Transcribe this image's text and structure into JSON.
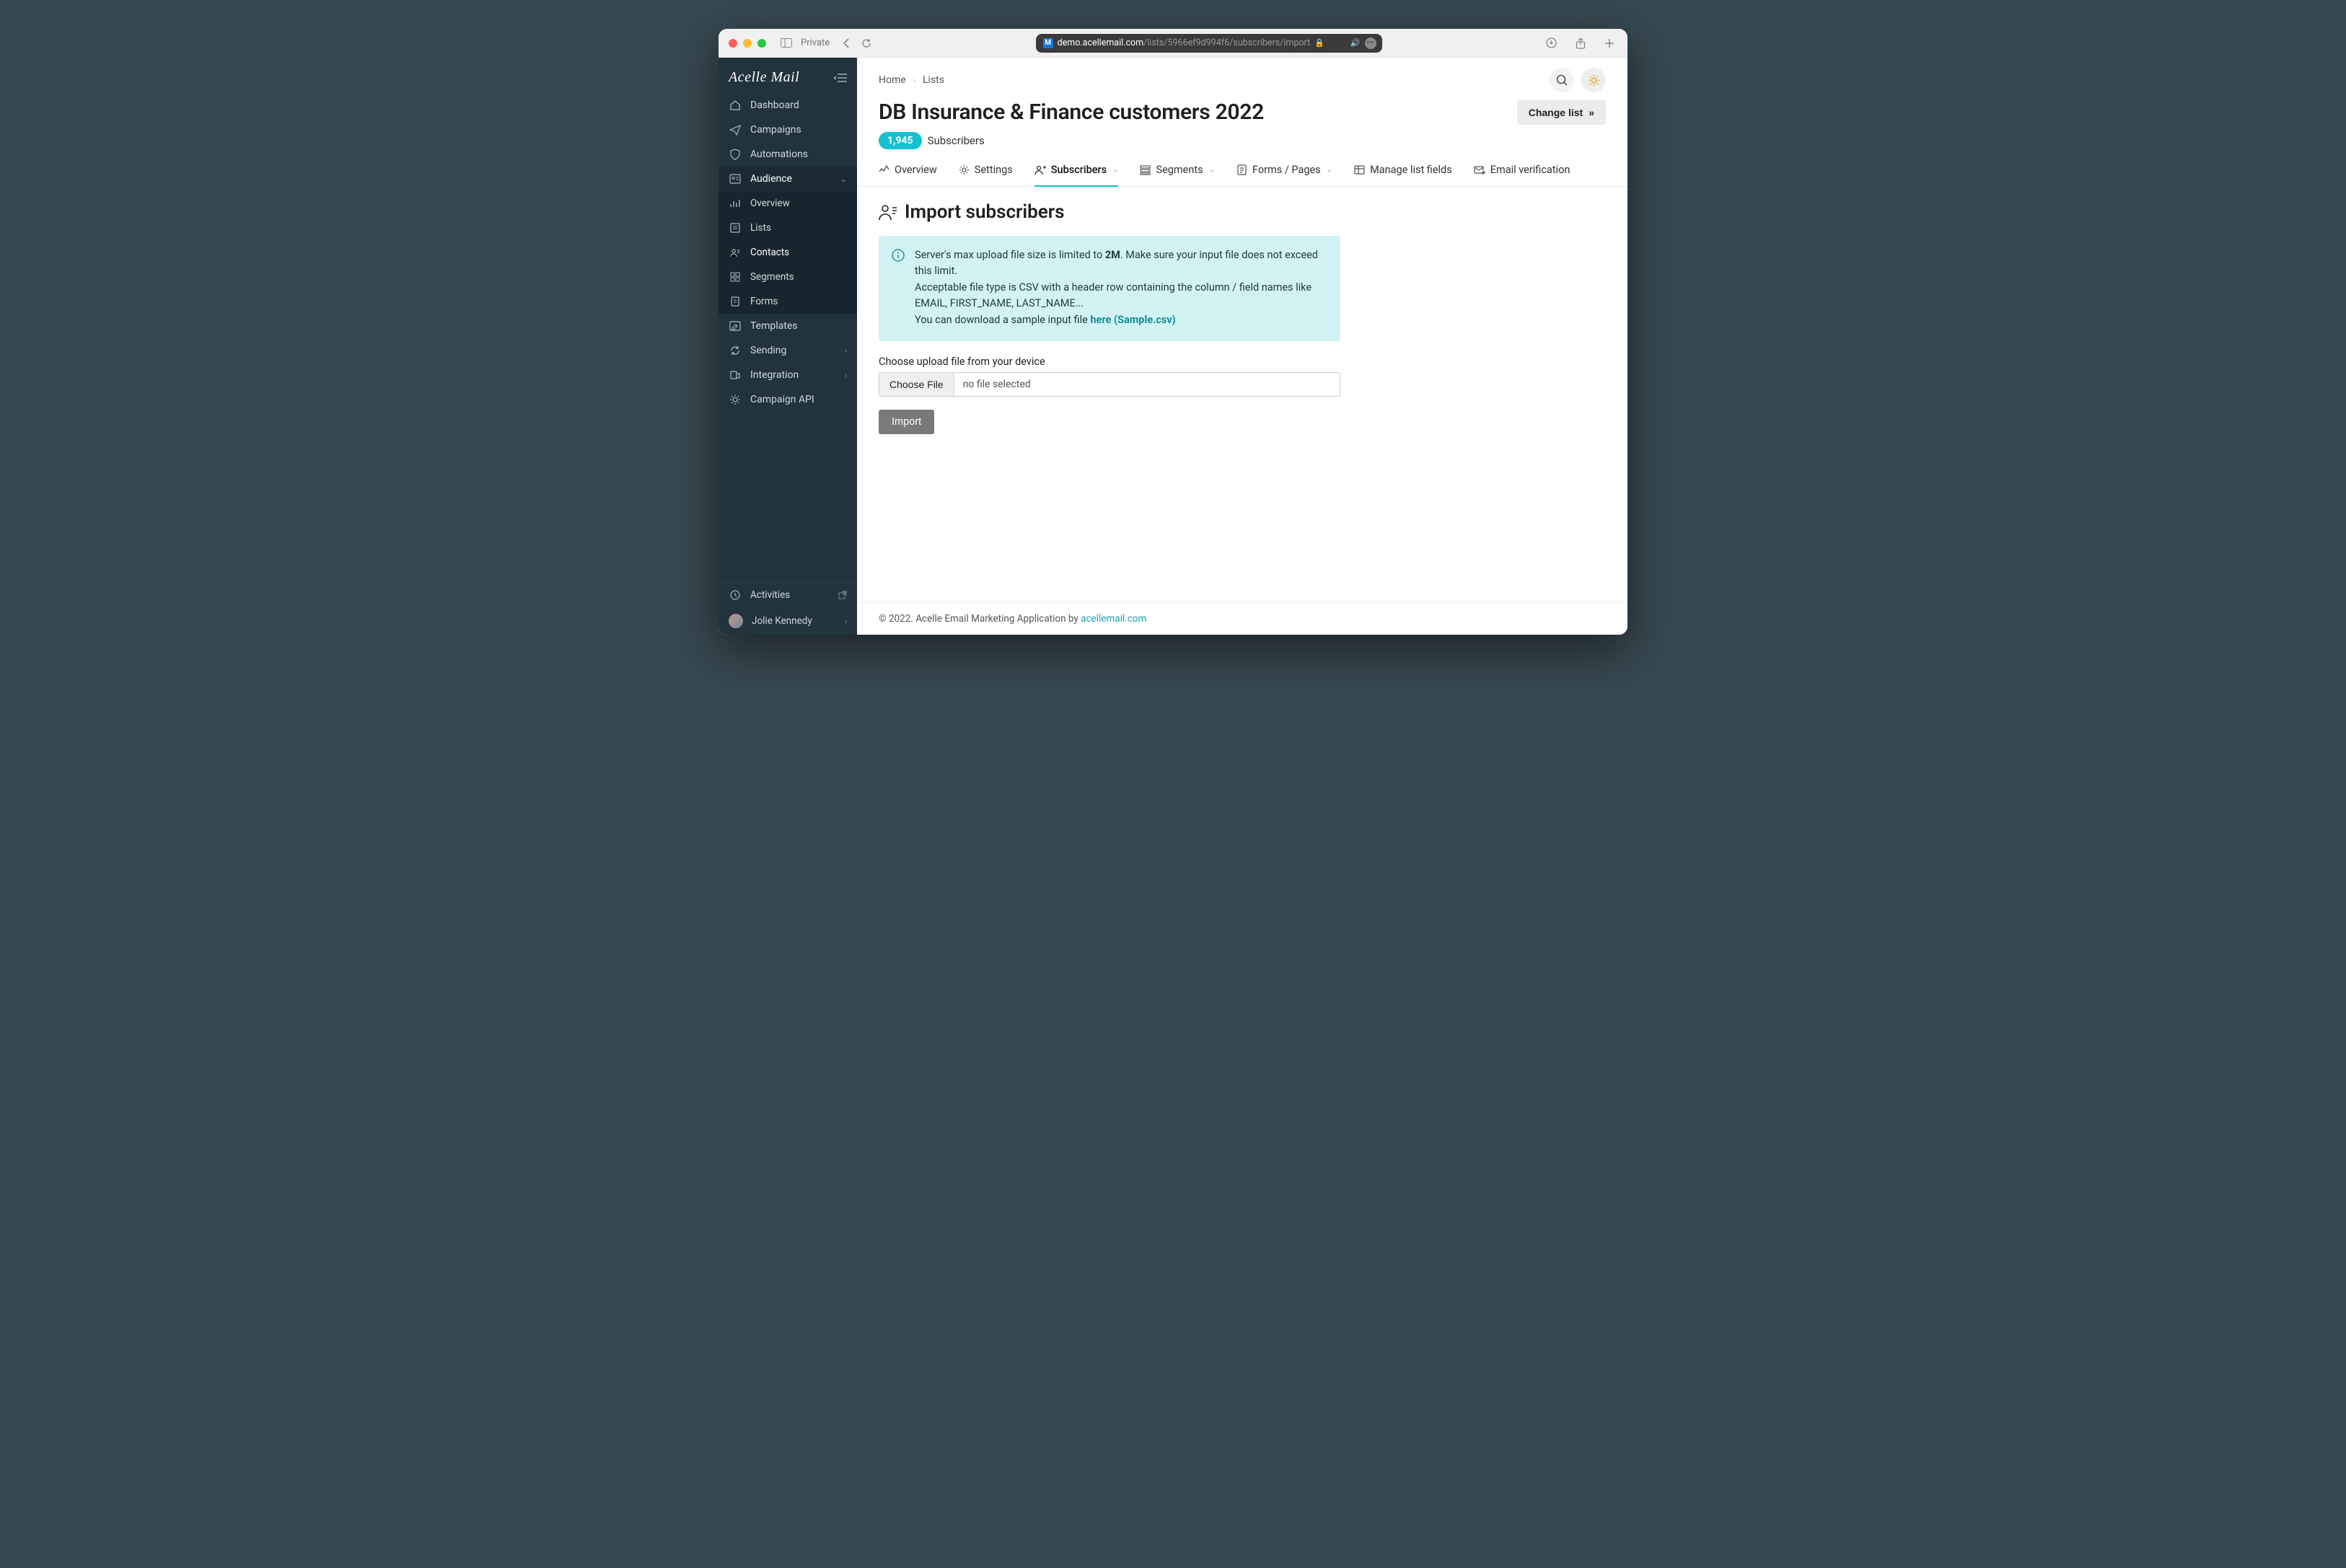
{
  "browser": {
    "private_label": "Private",
    "url_host": "demo.acellemail.com",
    "url_path": "/lists/5966ef9d994f6/subscribers/import"
  },
  "brand": "Acelle Mail",
  "sidebar": {
    "items": [
      {
        "label": "Dashboard"
      },
      {
        "label": "Campaigns"
      },
      {
        "label": "Automations"
      },
      {
        "label": "Audience",
        "expanded": true
      },
      {
        "label": "Templates"
      },
      {
        "label": "Sending",
        "chev": true
      },
      {
        "label": "Integration",
        "chev": true
      },
      {
        "label": "Campaign API"
      }
    ],
    "audience_sub": [
      {
        "label": "Overview"
      },
      {
        "label": "Lists"
      },
      {
        "label": "Contacts",
        "active": true
      },
      {
        "label": "Segments"
      },
      {
        "label": "Forms"
      }
    ],
    "footer": {
      "activities": "Activities",
      "user": "Jolie Kennedy"
    }
  },
  "breadcrumb": [
    "Home",
    "Lists"
  ],
  "top_actions": {
    "change_list": "Change list"
  },
  "page": {
    "title": "DB Insurance & Finance customers 2022",
    "sub_count": "1,945",
    "sub_label": "Subscribers"
  },
  "tabs": [
    {
      "label": "Overview"
    },
    {
      "label": "Settings"
    },
    {
      "label": "Subscribers",
      "chev": true,
      "active": true
    },
    {
      "label": "Segments",
      "chev": true
    },
    {
      "label": "Forms / Pages",
      "chev": true
    },
    {
      "label": "Manage list fields"
    },
    {
      "label": "Email verification"
    }
  ],
  "section": {
    "title": "Import subscribers"
  },
  "info": {
    "line1_a": "Server's max upload file size is limited to ",
    "line1_b": "2M",
    "line1_c": ". Make sure your input file does not exceed this limit.",
    "line2": "Acceptable file type is CSV with a header row containing the column / field names like EMAIL, FIRST_NAME, LAST_NAME...",
    "line3": "You can download a sample input file ",
    "link": "here (Sample.csv)"
  },
  "upload": {
    "label": "Choose upload file from your device",
    "button": "Choose File",
    "status": "no file selected",
    "import": "Import"
  },
  "footer": {
    "text": "© 2022. Acelle Email Marketing Application by ",
    "link": "acellemail.com"
  }
}
